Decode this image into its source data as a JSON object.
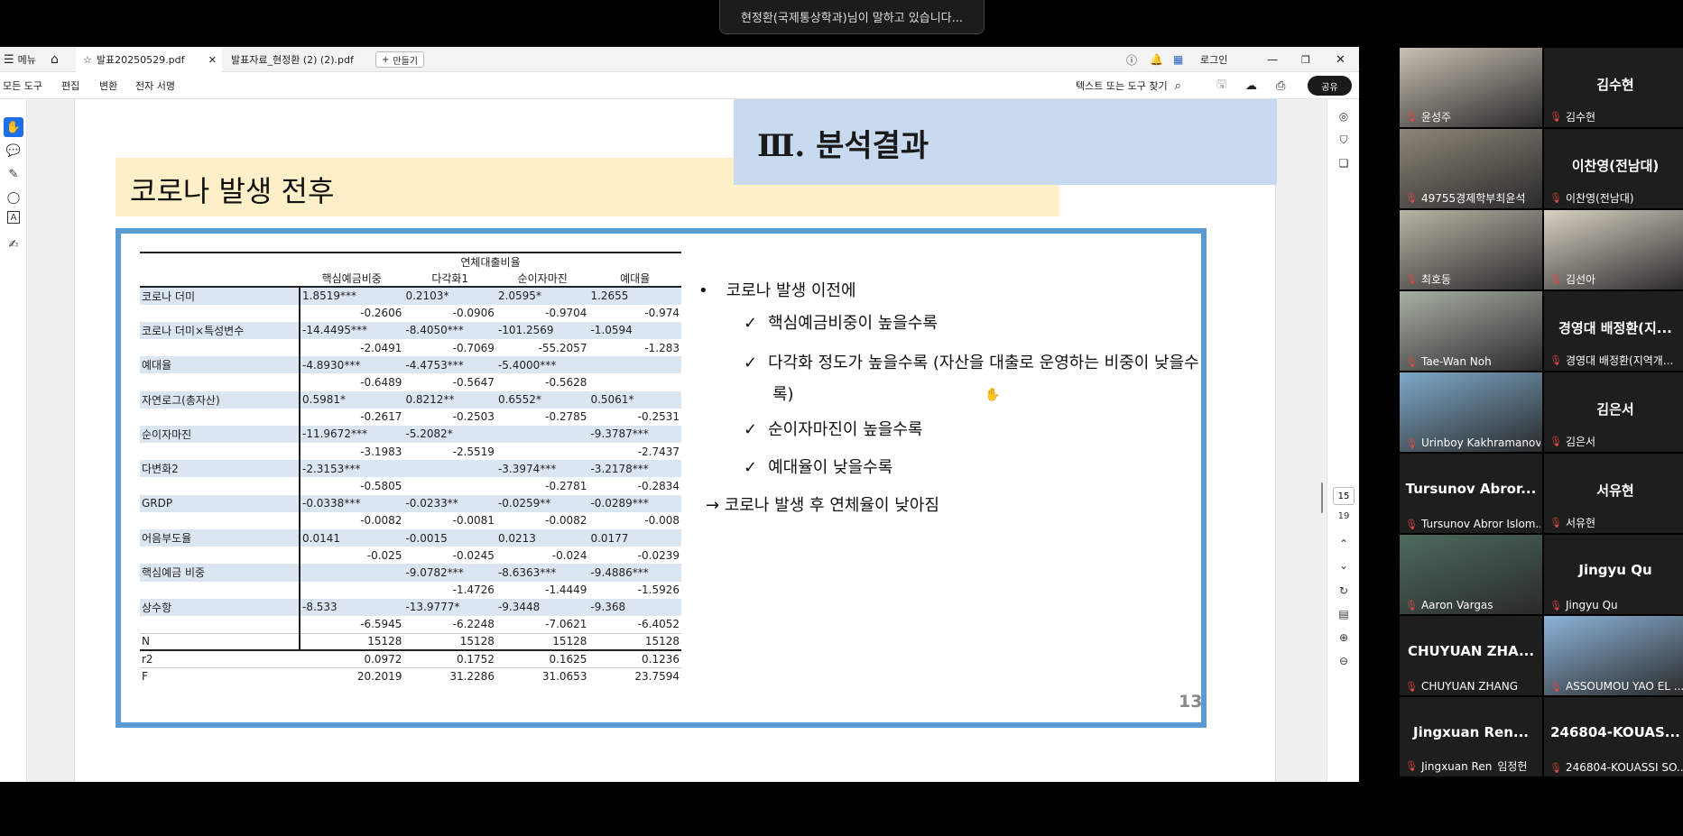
{
  "speaker_banner": "현정환(국제통상학과)님이 말하고 있습니다...",
  "titlebar": {
    "menu_label": "메뉴",
    "tabs": [
      {
        "label": "발표20250529.pdf"
      },
      {
        "label": "발표자료_현정환 (2) (2).pdf"
      }
    ],
    "new_tab_label": "만들기",
    "login_label": "로그인"
  },
  "toolbar": {
    "menus": [
      "모든 도구",
      "편집",
      "변환",
      "전자 서명"
    ],
    "search_placeholder": "텍스트 또는 도구 찾기",
    "share_label": "공유"
  },
  "page_nav": {
    "current": "15",
    "total": "19"
  },
  "slide": {
    "section_title": "Ⅲ. 분석결과",
    "subtitle": "코로나 발생 전후",
    "page_number": "13",
    "table": {
      "group_header": "연체대출비율",
      "columns": [
        "핵심예금비중",
        "다각화1",
        "순이자마진",
        "예대율"
      ],
      "rows": [
        {
          "label": "코로나 더미",
          "coef": [
            "1.8519***",
            "0.2103*",
            "2.0595*",
            "1.2655"
          ],
          "se": [
            "-0.2606",
            "-0.0906",
            "-0.9704",
            "-0.974"
          ]
        },
        {
          "label": "코로나 더미×특성변수",
          "coef": [
            "-14.4495***",
            "-8.4050***",
            "-101.2569",
            "-1.0594"
          ],
          "se": [
            "-2.0491",
            "-0.7069",
            "-55.2057",
            "-1.283"
          ]
        },
        {
          "label": "예대율",
          "coef": [
            "-4.8930***",
            "-4.4753***",
            "-5.4000***",
            ""
          ],
          "se": [
            "-0.6489",
            "-0.5647",
            "-0.5628",
            ""
          ]
        },
        {
          "label": "자연로그(총자산)",
          "coef": [
            "0.5981*",
            "0.8212**",
            "0.6552*",
            "0.5061*"
          ],
          "se": [
            "-0.2617",
            "-0.2503",
            "-0.2785",
            "-0.2531"
          ]
        },
        {
          "label": "순이자마진",
          "coef": [
            "-11.9672***",
            "-5.2082*",
            "",
            "-9.3787***"
          ],
          "se": [
            "-3.1983",
            "-2.5519",
            "",
            "-2.7437"
          ]
        },
        {
          "label": "다변화2",
          "coef": [
            "-2.3153***",
            "",
            "-3.3974***",
            "-3.2178***"
          ],
          "se": [
            "-0.5805",
            "",
            "-0.2781",
            "-0.2834"
          ]
        },
        {
          "label": "GRDP",
          "coef": [
            "-0.0338***",
            "-0.0233**",
            "-0.0259**",
            "-0.0289***"
          ],
          "se": [
            "-0.0082",
            "-0.0081",
            "-0.0082",
            "-0.008"
          ]
        },
        {
          "label": "어음부도율",
          "coef": [
            "0.0141",
            "-0.0015",
            "0.0213",
            "0.0177"
          ],
          "se": [
            "-0.025",
            "-0.0245",
            "-0.024",
            "-0.0239"
          ]
        },
        {
          "label": "핵심예금 비중",
          "coef": [
            "",
            "-9.0782***",
            "-8.6363***",
            "-9.4886***"
          ],
          "se": [
            "",
            "-1.4726",
            "-1.4449",
            "-1.5926"
          ]
        },
        {
          "label": "상수항",
          "coef": [
            "-8.533",
            "-13.9777*",
            "-9.3448",
            "-9.368"
          ],
          "se": [
            "-6.5945",
            "-6.2248",
            "-7.0621",
            "-6.4052"
          ]
        }
      ],
      "stats": [
        {
          "label": "N",
          "values": [
            "15128",
            "15128",
            "15128",
            "15128"
          ]
        },
        {
          "label": "r2",
          "values": [
            "0.0972",
            "0.1752",
            "0.1625",
            "0.1236"
          ]
        },
        {
          "label": "F",
          "values": [
            "20.2019",
            "31.2286",
            "31.0653",
            "23.7594"
          ]
        }
      ]
    },
    "bullets": {
      "main": "코로나 발생 이전에",
      "checks": [
        "핵심예금비중이 높을수록",
        "다각화 정도가 높을수록 (자산을 대출로 운영하는 비중이 낮을수",
        "록)",
        "순이자마진이 높을수록",
        "예대율이 낮을수록"
      ],
      "conclusion": "→ 코로나 발생 후 연체율이 낮아짐"
    }
  },
  "participants": [
    {
      "name": "윤성주",
      "big": "",
      "video": true,
      "color": "#c9c0b3"
    },
    {
      "name": "김수현",
      "big": "김수현",
      "video": false
    },
    {
      "name": "49755경제학부최윤석",
      "big": "",
      "video": true,
      "color": "#8e8678"
    },
    {
      "name": "이찬영(전남대)",
      "big": "이찬영(전남대)",
      "video": false
    },
    {
      "name": "최호동",
      "big": "",
      "video": true,
      "color": "#b9b4a6"
    },
    {
      "name": "김선아",
      "big": "",
      "video": true,
      "color": "#d9d1c4"
    },
    {
      "name": "Tae-Wan Noh",
      "big": "",
      "video": true,
      "color": "#a8b0a4"
    },
    {
      "name": "경영대 배정환(지역개...",
      "big": "경영대 배정환(지...",
      "video": false
    },
    {
      "name": "Urinboy Kakhramanov",
      "big": "",
      "video": true,
      "color": "#7da9c9"
    },
    {
      "name": "김은서",
      "big": "김은서",
      "video": false
    },
    {
      "name": "Tursunov Abror Islom...",
      "big": "Tursunov Abror...",
      "video": false
    },
    {
      "name": "서유현",
      "big": "서유현",
      "video": false
    },
    {
      "name": "Aaron Vargas",
      "big": "",
      "video": true,
      "color": "#4d6b5e"
    },
    {
      "name": "Jingyu Qu",
      "big": "Jingyu Qu",
      "video": false
    },
    {
      "name": "CHUYUAN ZHANG",
      "big": "CHUYUAN ZHA...",
      "video": false
    },
    {
      "name": "ASSOUMOU YAO EL ...",
      "big": "",
      "video": true,
      "color": "#8cb4d9"
    },
    {
      "name": "Jingxuan Ren",
      "big": "Jingxuan Ren...",
      "video": false,
      "extra": "임정헌"
    },
    {
      "name": "246804-KOUASSI SO...",
      "big": "246804-KOUAS...",
      "video": false
    }
  ]
}
